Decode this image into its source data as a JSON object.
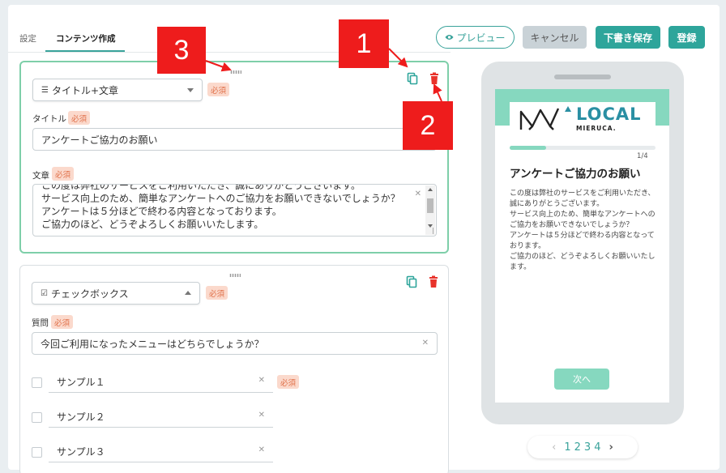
{
  "tabs": {
    "settings": "設定",
    "content": "コンテンツ作成"
  },
  "header": {
    "preview": "プレビュー",
    "cancel": "キャンセル",
    "draft": "下書き保存",
    "register": "登録"
  },
  "required": "必須",
  "card1": {
    "type_select": "タイトル+文章",
    "title_label": "タイトル",
    "title_value": "アンケートご協力のお願い",
    "body_label": "文章",
    "body_lines": [
      "この度は弊社のサービスをご利用いただき、誠にありがとうございます。",
      "サービス向上のため、簡単なアンケートへのご協力をお願いできないでしょうか？",
      "アンケートは５分ほどで終わる内容となっております。",
      "ご協力のほど、どうぞよろしくお願いいたします。"
    ]
  },
  "card2": {
    "type_select": "チェックボックス",
    "question_label": "質問",
    "question_value": "今回ご利用になったメニューはどちらでしょうか？",
    "options": [
      "サンプル１",
      "サンプル２",
      "サンプル３"
    ]
  },
  "preview": {
    "logo_text": "LOCAL",
    "logo_sub": "MIERUCA.",
    "page_count": "1/4",
    "progress_fraction": 0.25,
    "title": "アンケートご協力のお願い",
    "body": "この度は弊社のサービスをご利用いただき、誠にありがとうございます。\nサービス向上のため、簡単なアンケートへのご協力をお願いできないでしょうか？\nアンケートは５分ほどで終わる内容となっております。\nご協力のほど、どうぞよろしくお願いいたします。",
    "next": "次へ"
  },
  "pager": {
    "prev": "‹",
    "pages": [
      "1",
      "2",
      "3",
      "4"
    ],
    "next": "›"
  },
  "annotations": {
    "m1": "1",
    "m2": "2",
    "m3": "3"
  },
  "colors": {
    "accent": "#2ea59b",
    "required_bg": "#fbd9cc",
    "required_text": "#e0714a",
    "delete": "#e8332b",
    "marker": "#ee1c1c"
  },
  "icons": {
    "copy": "copy-icon",
    "delete": "trash-icon",
    "drag": "drag-handle-icon",
    "eye": "eye-icon"
  }
}
